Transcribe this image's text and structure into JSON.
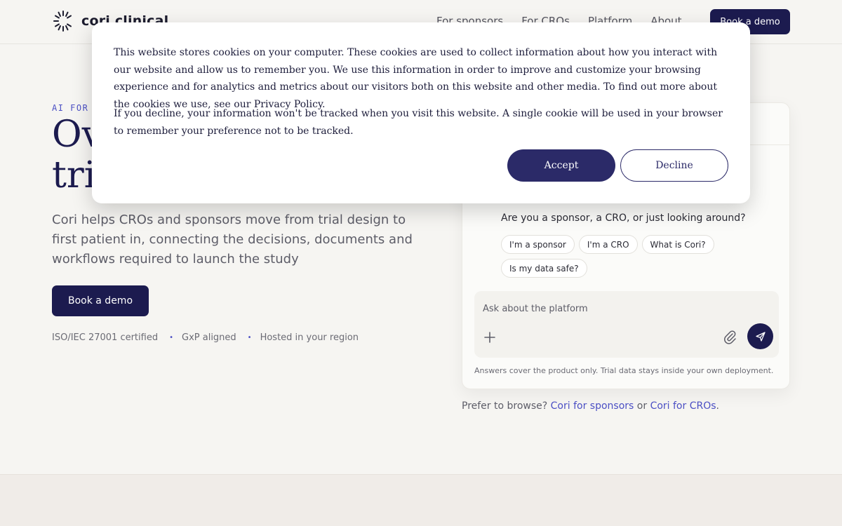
{
  "header": {
    "brand": "cori clinical",
    "nav": [
      "For sponsors",
      "For CROs",
      "Platform",
      "About"
    ],
    "cta": "Book a demo"
  },
  "hero": {
    "eyebrow": "AI FOR",
    "title_line1": "Ov",
    "title_line2": "tri",
    "subtitle": "Cori helps CROs and sponsors move from trial design to first patient in, connecting the decisions, documents and workflows required to launch the study",
    "cta": "Book a demo",
    "trust": [
      "ISO/IEC 27001 certified",
      "GxP aligned",
      "Hosted in your region"
    ],
    "trust_separator": "•"
  },
  "chat": {
    "question": "Are you a sponsor, a CRO, or just looking around?",
    "chips": [
      "I'm a sponsor",
      "I'm a CRO",
      "What is Cori?",
      "Is my data safe?"
    ],
    "input_placeholder": "Ask about the platform",
    "disclaimer": "Answers cover the product only. Trial data stays inside your own deployment."
  },
  "browse": {
    "prefix": "Prefer to browse?",
    "link1": "Cori for sponsors",
    "middle": "or",
    "link2": "Cori for CROs",
    "suffix": "."
  },
  "cookie": {
    "paragraph1": "This website stores cookies on your computer. These cookies are used to collect information about how you interact with our website and allow us to remember you. We use this information in order to improve and customize your browsing experience and for analytics and metrics about our visitors both on this website and other media. To find out more about the cookies we use, see our Privacy Policy.",
    "paragraph2": "If you decline, your information won't be tracked when you visit this website. A single cookie will be used in your browser to remember your preference not to be tracked.",
    "accept": "Accept",
    "decline": "Decline"
  },
  "colors": {
    "brand_navy": "#1c1b4f",
    "accent_indigo": "#4b4fc4",
    "page_bg": "#f6f5f2",
    "cookie_accept": "#2b2a68"
  },
  "icons": [
    "logo-spinner-icon",
    "plus-icon",
    "paperclip-icon",
    "send-icon"
  ]
}
